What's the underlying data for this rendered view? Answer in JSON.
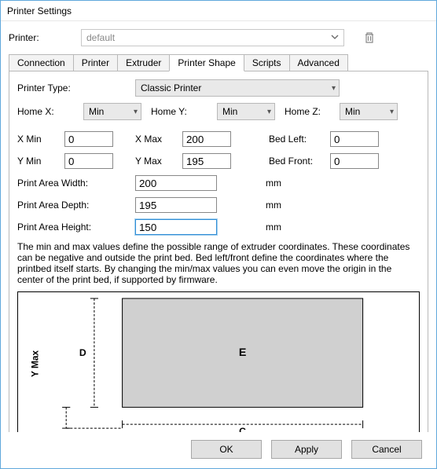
{
  "window": {
    "title": "Printer Settings"
  },
  "printer_row": {
    "label": "Printer:",
    "selected": "default"
  },
  "tabs": {
    "connection": "Connection",
    "printer": "Printer",
    "extruder": "Extruder",
    "printer_shape": "Printer Shape",
    "scripts": "Scripts",
    "advanced": "Advanced"
  },
  "shape": {
    "printer_type_label": "Printer Type:",
    "printer_type_value": "Classic Printer",
    "home_x_label": "Home X:",
    "home_x_value": "Min",
    "home_y_label": "Home Y:",
    "home_y_value": "Min",
    "home_z_label": "Home Z:",
    "home_z_value": "Min",
    "xmin_label": "X Min",
    "xmin_value": "0",
    "xmax_label": "X Max",
    "xmax_value": "200",
    "bed_left_label": "Bed Left:",
    "bed_left_value": "0",
    "ymin_label": "Y Min",
    "ymin_value": "0",
    "ymax_label": "Y Max",
    "ymax_value": "195",
    "bed_front_label": "Bed Front:",
    "bed_front_value": "0",
    "area_width_label": "Print Area Width:",
    "area_width_value": "200",
    "area_depth_label": "Print Area Depth:",
    "area_depth_value": "195",
    "area_height_label": "Print Area Height:",
    "area_height_value": "150",
    "unit": "mm",
    "description": "The min and max values define the possible range of extruder coordinates. These coordinates can be negative and outside the print bed. Bed left/front define the coordinates where the printbed itself starts. By changing the min/max values you can even move the origin in the center of the print bed, if supported by firmware."
  },
  "diagram": {
    "y_axis": "Y Max",
    "depth": "D",
    "extruder": "E",
    "width": "C"
  },
  "buttons": {
    "ok": "OK",
    "apply": "Apply",
    "cancel": "Cancel"
  }
}
